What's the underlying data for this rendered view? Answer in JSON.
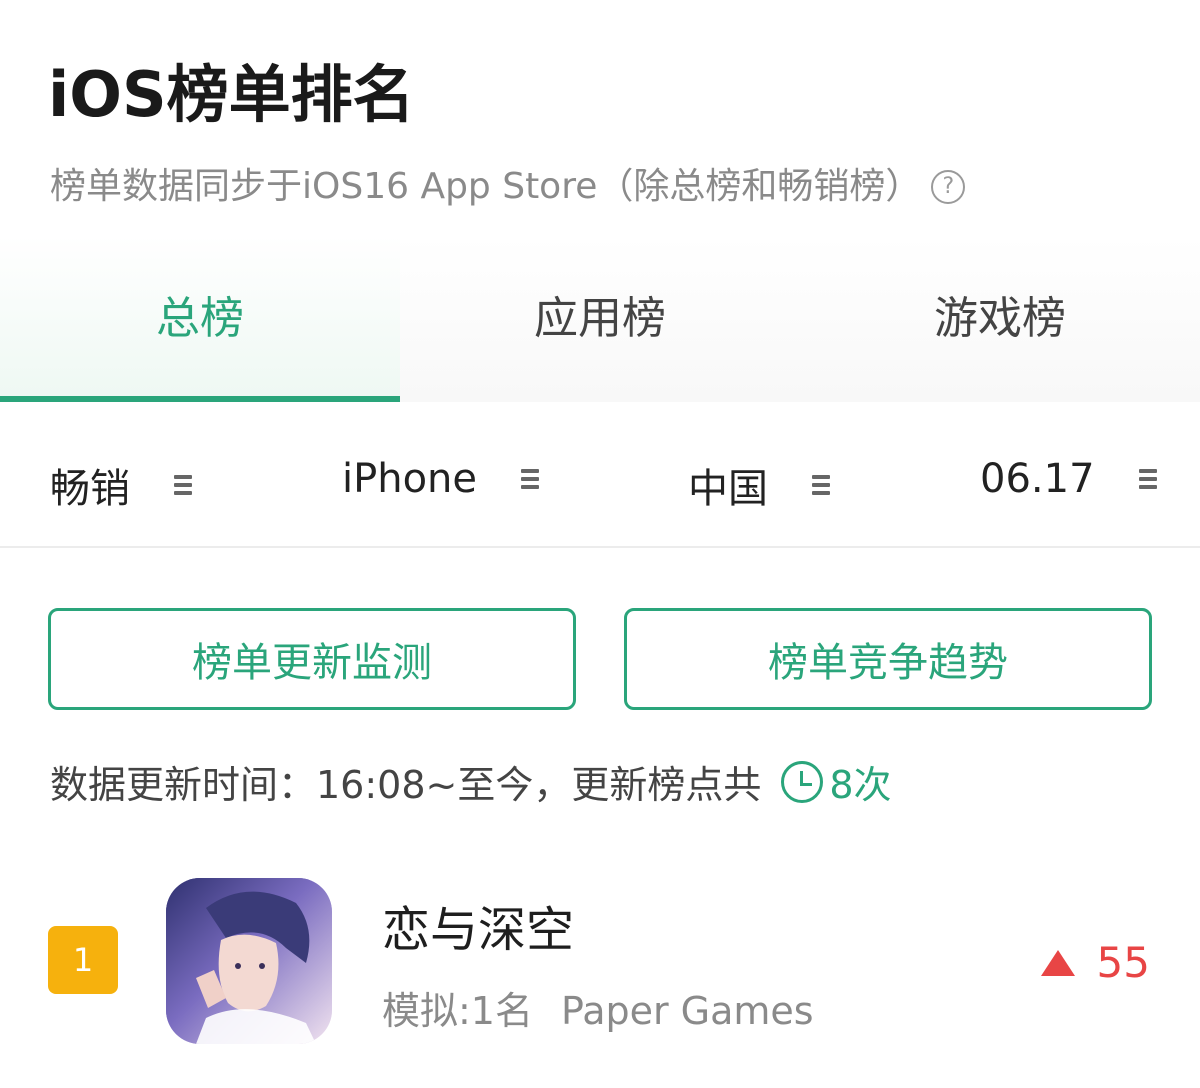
{
  "header": {
    "title": "iOS榜单排名",
    "subtitle": "榜单数据同步于iOS16 App Store（除总榜和畅销榜）",
    "help_symbol": "?"
  },
  "tabs": [
    {
      "label": "总榜",
      "active": true
    },
    {
      "label": "应用榜",
      "active": false
    },
    {
      "label": "游戏榜",
      "active": false
    }
  ],
  "filters": [
    {
      "value": "畅销",
      "icon": "menu-icon"
    },
    {
      "value": "iPhone",
      "icon": "menu-icon"
    },
    {
      "value": "中国",
      "icon": "menu-icon"
    },
    {
      "value": "06.17",
      "icon": "menu-icon"
    }
  ],
  "actions": {
    "monitor_label": "榜单更新监测",
    "trend_label": "榜单竞争趋势"
  },
  "update_info": {
    "text": "数据更新时间：16:08~至今，更新榜点共",
    "count": "8次"
  },
  "rankings": [
    {
      "rank": "1",
      "name": "恋与深空",
      "simulated_rank": "模拟:1名",
      "developer": "Paper Games",
      "change": "55",
      "change_direction": "up"
    }
  ],
  "colors": {
    "accent": "#2aa57b",
    "rank_badge": "#f6b10d",
    "rise": "#e84545"
  }
}
